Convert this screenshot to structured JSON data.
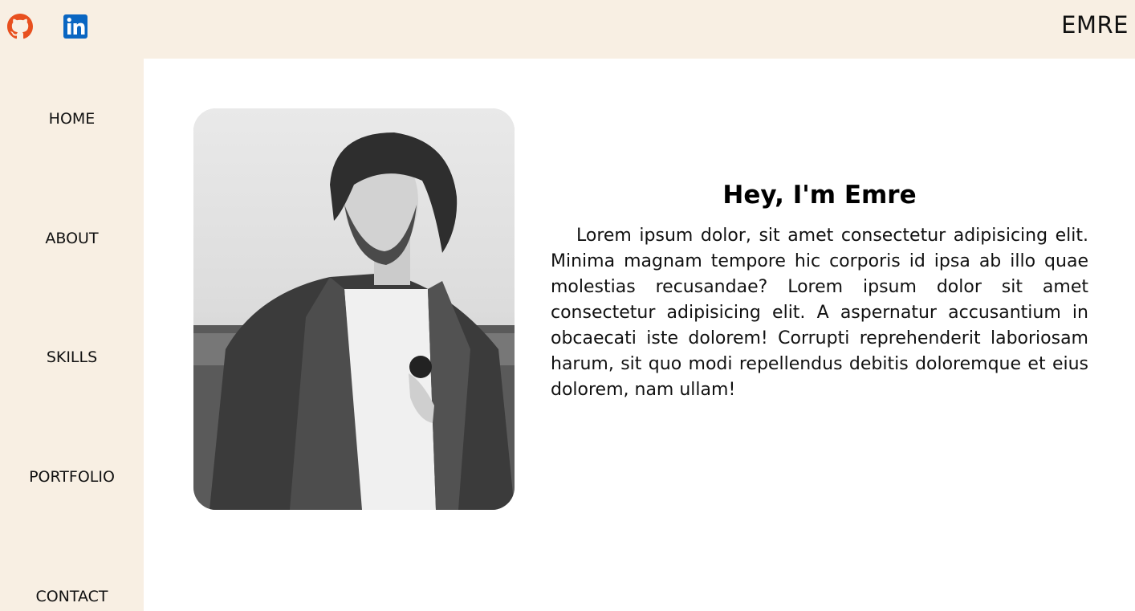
{
  "header": {
    "brand": "EMRE",
    "social": [
      {
        "icon": "github-icon",
        "color": "#e8501f"
      },
      {
        "icon": "linkedin-icon",
        "color": "#0a66c2"
      }
    ]
  },
  "sidebar": {
    "items": [
      {
        "label": "HOME"
      },
      {
        "label": "ABOUT"
      },
      {
        "label": "SKILLS"
      },
      {
        "label": "PORTFOLIO"
      },
      {
        "label": "CONTACT"
      }
    ]
  },
  "main": {
    "photo": {
      "description": "black-and-white portrait photo",
      "icon": "profile-photo"
    },
    "greeting": "Hey, I'm Emre",
    "bio": "Lorem ipsum dolor, sit amet consectetur adipisicing elit. Minima magnam tempore hic corporis id ipsa ab illo quae molestias recusandae? Lorem ipsum dolor sit amet consectetur adipisicing elit. A aspernatur accusantium in obcaecati iste dolorem! Corrupti reprehenderit laboriosam harum, sit quo modi repellendus debitis doloremque et eius dolorem, nam ullam!"
  },
  "colors": {
    "panel_bg": "#f8efe3",
    "content_bg": "#ffffff",
    "text": "#111111"
  }
}
